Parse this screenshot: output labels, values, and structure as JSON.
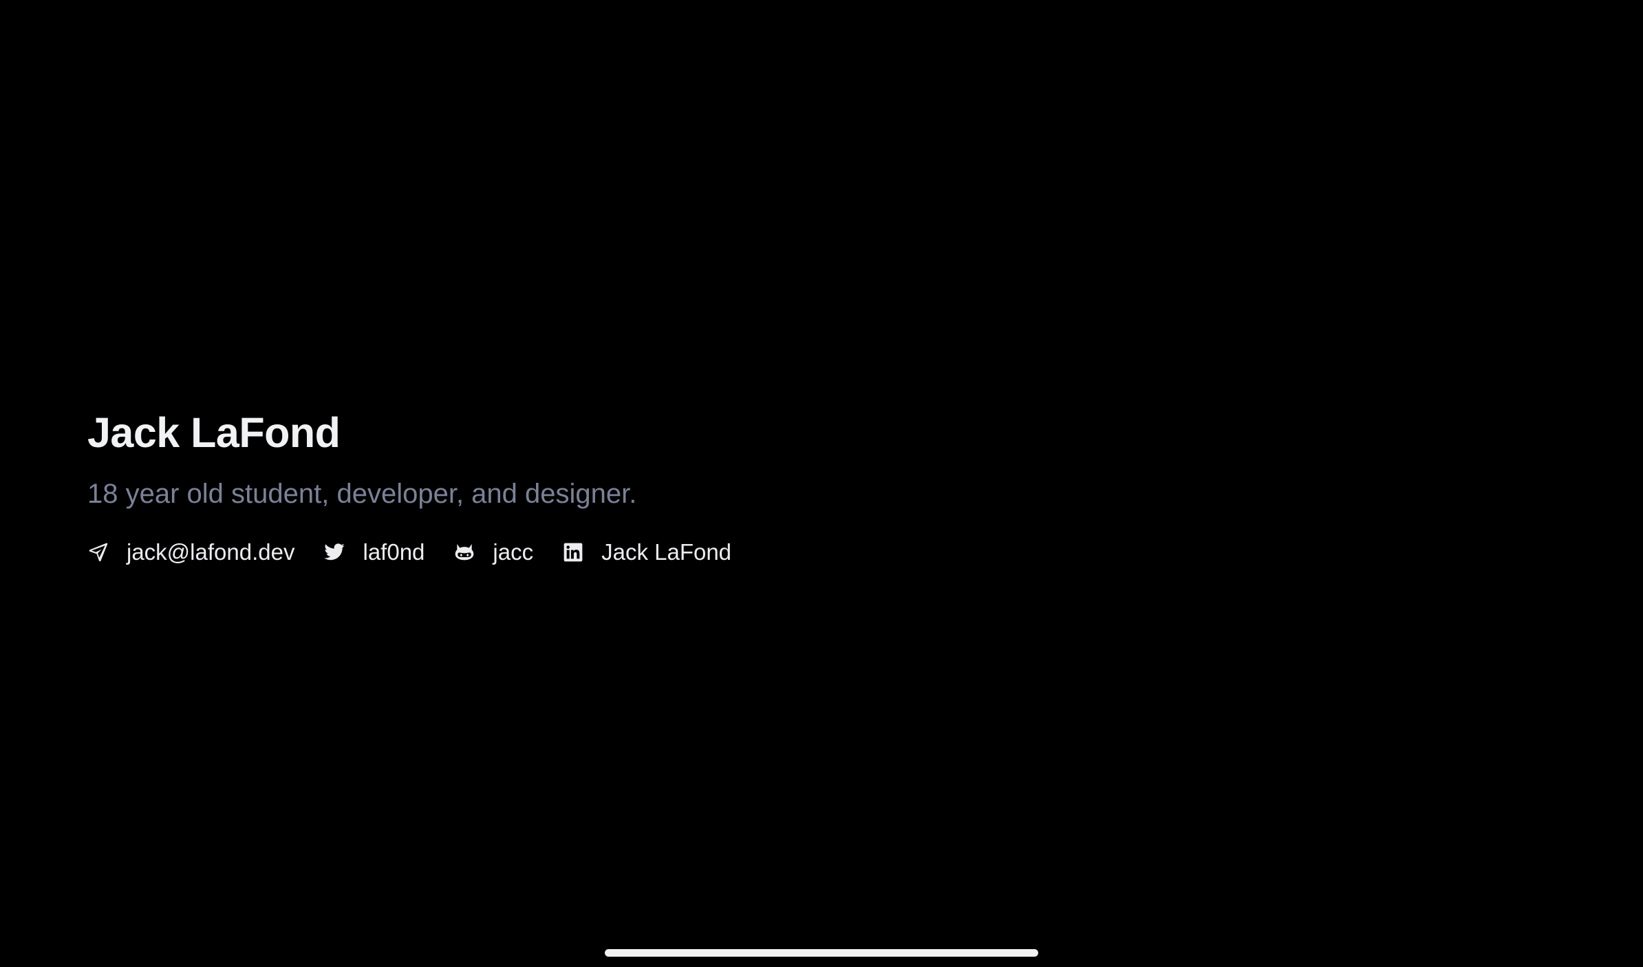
{
  "profile": {
    "name": "Jack LaFond",
    "tagline": "18 year old student, developer, and designer."
  },
  "links": [
    {
      "icon": "send-icon",
      "label": "jack@lafond.dev"
    },
    {
      "icon": "twitter-icon",
      "label": "laf0nd"
    },
    {
      "icon": "github-icon",
      "label": "jacc"
    },
    {
      "icon": "linkedin-icon",
      "label": "Jack LaFond"
    }
  ],
  "colors": {
    "background": "#000000",
    "name": "#f1f2f4",
    "tagline": "#7b8196",
    "link": "#ededf0",
    "home_indicator": "#f2f2f2"
  }
}
